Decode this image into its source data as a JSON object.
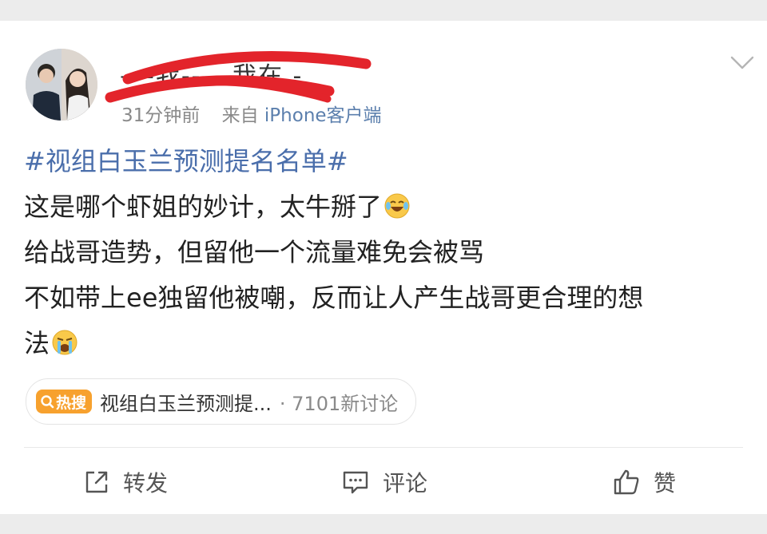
{
  "header": {
    "username": "—-我-----我在 -",
    "time": "31分钟前",
    "source_prefix": "来自",
    "source_client": "iPhone客户端"
  },
  "post": {
    "topic": "#视组白玉兰预测提名名单#",
    "line1": "这是哪个虾姐的妙计，太牛掰了",
    "line2_a": "给战哥造势，但留他一个",
    "line2_b": "流量难免会被骂",
    "line3": "不如带上ee独留他被嘲，反而让人产生战哥更合理的想",
    "line4": "法"
  },
  "hot": {
    "badge": "热搜",
    "title": "视组白玉兰预测提...",
    "count": "· 7101新讨论"
  },
  "actions": {
    "repost": "转发",
    "comment": "评论",
    "like": "赞"
  },
  "icons": {
    "chevron": "chevron-down-icon",
    "laugh_cry": "laughing-crying-emoji-icon",
    "crying": "crying-emoji-icon",
    "search": "search-icon",
    "repost": "share-icon",
    "comment": "comment-icon",
    "like": "thumbs-up-icon"
  },
  "colors": {
    "topic": "#4a6eab",
    "hot_badge": "#f7a12e",
    "scribble": "#e3242b"
  }
}
